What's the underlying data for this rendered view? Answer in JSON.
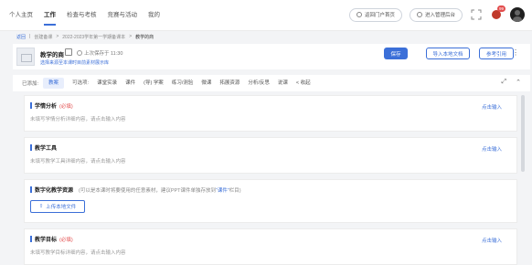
{
  "topnav": {
    "items": [
      "个人主页",
      "工作",
      "检查与考核",
      "竞赛与活动",
      "我的"
    ],
    "pill_1": "返回门户首页",
    "pill_2": "进入管理后台",
    "badge_count": "99"
  },
  "breadcrumb": {
    "items": [
      "返回",
      "创建备课",
      "2022-2023学年第一学期备课本"
    ],
    "current": "教学的商"
  },
  "header": {
    "doc_title": "教学的商",
    "saved_text": "上次保存于 11:30",
    "sub_link": "选择来源至本课时目前素材展示库",
    "save_label": "保存",
    "import_label": "导入本地文档",
    "reference_label": "参考引用"
  },
  "tabbar": {
    "prefix": "已添加:",
    "active_tab": "教案",
    "optional_label": "可选项:",
    "tabs": [
      "课堂实录",
      "课件",
      "(导) 学案",
      "练习/测验",
      "微课",
      "拓展资源",
      "分析/反思",
      "说课",
      "< 收起"
    ]
  },
  "sections": [
    {
      "title": "学情分析",
      "required": "(必填)",
      "desc": "未填写学情分析详细内容，请点击输入内容",
      "action": "点击输入"
    },
    {
      "title": "教学工具",
      "desc": "未填写教学工具详细内容，请点击输入内容",
      "action": "点击输入"
    },
    {
      "title": "数字化教学资源",
      "hint_pre": "(可以是本课时将要使用的任意素材，建议PPT课件单独存放到",
      "hint_link": "“课件”",
      "hint_post": "栏目)",
      "upload_label": "上传本地文件"
    },
    {
      "title": "教学目标",
      "required": "(必填)",
      "desc": "未填写教学目标详细内容，请点击输入内容",
      "action": "点击输入"
    }
  ],
  "colors": {
    "accent": "#3b6fd8",
    "required": "#e34d4d"
  }
}
